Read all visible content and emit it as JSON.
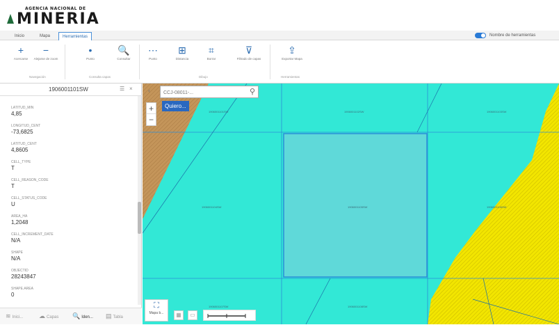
{
  "header": {
    "logo_small": "AGENCIA NACIONAL DE",
    "logo_big": "MINERIA",
    "brand_color": "#1f6b3a"
  },
  "tabs": [
    {
      "label": "Inicio"
    },
    {
      "label": "Mapa"
    },
    {
      "label": "Herramientas",
      "active": true
    }
  ],
  "toggle": {
    "label": "Nombre de herramientas",
    "on": true
  },
  "ribbon": {
    "buttons": [
      {
        "icon": "zoom-in-icon",
        "glyph": "+",
        "label": "Acercarse"
      },
      {
        "icon": "zoom-out-icon",
        "glyph": "−",
        "label": "Alejarse de zoom"
      },
      {
        "icon": "point-icon",
        "glyph": "•",
        "label": "Punto"
      },
      {
        "icon": "magnify-icon",
        "glyph": "🔍",
        "label": "Consultar"
      },
      {
        "icon": "dots-icon",
        "glyph": "⋯",
        "label": "Punto"
      },
      {
        "icon": "measure-icon",
        "glyph": "⊞",
        "label": "Distancia"
      },
      {
        "icon": "clear-icon",
        "glyph": "⌗",
        "label": "Borrar"
      },
      {
        "icon": "filter-icon",
        "glyph": "⊽",
        "label": "Filtrado de capas"
      },
      {
        "icon": "export-icon",
        "glyph": "⇪",
        "label": "Exportar Mapa"
      }
    ],
    "groups": [
      "Navegación",
      "Consulta capas",
      "Dibujo",
      "Herramientas"
    ]
  },
  "panel": {
    "title": "1906001101SW",
    "attributes": [
      {
        "key": "LATITUD_MIN",
        "value": "4,85"
      },
      {
        "key": "LONGITUD_CENT",
        "value": "-73,6825"
      },
      {
        "key": "LATITUD_CENT",
        "value": "4,8605"
      },
      {
        "key": "CELL_TYPE",
        "value": "T"
      },
      {
        "key": "CELL_REASON_CODE",
        "value": "T"
      },
      {
        "key": "CELL_STATUS_CODE",
        "value": "U"
      },
      {
        "key": "AREA_HA",
        "value": "1,2048"
      },
      {
        "key": "CELL_INCREMENT_DATE",
        "value": "N/A"
      },
      {
        "key": "SHAPE",
        "value": "N/A"
      },
      {
        "key": "OBJECTID",
        "value": "28243847"
      },
      {
        "key": "SHAPE.AREA",
        "value": "0"
      }
    ],
    "bottom_tabs": [
      {
        "icon": "layers-icon",
        "glyph": "≋",
        "label": "Inici..."
      },
      {
        "icon": "cloud-icon",
        "glyph": "☁",
        "label": "Capas"
      },
      {
        "icon": "search-icon",
        "glyph": "🔍",
        "label": "Iden...",
        "active": true
      },
      {
        "icon": "table-icon",
        "glyph": "▤",
        "label": "Tabla"
      }
    ]
  },
  "map": {
    "search_placeholder": "CCJ-08011-...",
    "quiero_label": "Quiero...",
    "basemap_label": "Mapa b...",
    "colors": {
      "cyan": "#32e8d6",
      "brown": "#c4955a",
      "yellow": "#f2e500",
      "selected": "#5fd9d9",
      "grid": "#2b8ed8"
    },
    "cell_labels": [
      "1906001101SW",
      "1906001102SW",
      "1906001103SW",
      "1906001104SW",
      "1906001105SW",
      "1906001106SW",
      "1906001107SW",
      "1906001108SW"
    ]
  }
}
